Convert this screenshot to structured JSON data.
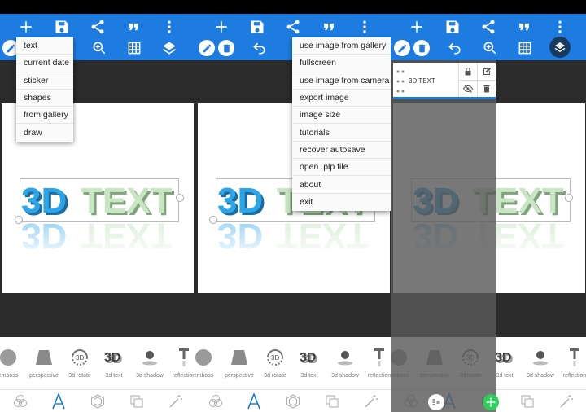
{
  "colors": {
    "toolbar": "#1e7ce0",
    "blue_text": "#2aa5e8",
    "green_text": "#b7dcb2"
  },
  "canvas_text": "3D TEXT",
  "canvas_text_parts": [
    "3D",
    "TEXT"
  ],
  "insert_menu": [
    "text",
    "current date",
    "sticker",
    "shapes",
    "from gallery",
    "draw"
  ],
  "more_menu": [
    "use image from gallery",
    "fullscreen",
    "use image from camera",
    "export image",
    "image size",
    "tutorials",
    "recover autosave",
    "open .plp file",
    "about",
    "exit"
  ],
  "effects": [
    "emboss",
    "perspective",
    "3d rotate",
    "3d text",
    "3d shadow",
    "reflection"
  ],
  "layer": {
    "name": "3D TEXT"
  },
  "icons": {
    "toolbar_top": [
      "add-icon",
      "save-icon",
      "share-icon",
      "quote-icon",
      "more-vert-icon"
    ],
    "toolbar_bottom": [
      "edit-icon",
      "delete-icon",
      "undo-icon",
      "zoom-in-icon",
      "grid-icon",
      "layers-icon"
    ],
    "bottom_nav": [
      "blend-icon",
      "text-format-icon",
      "shape-icon",
      "duplicate-icon",
      "magic-wand-icon"
    ]
  }
}
